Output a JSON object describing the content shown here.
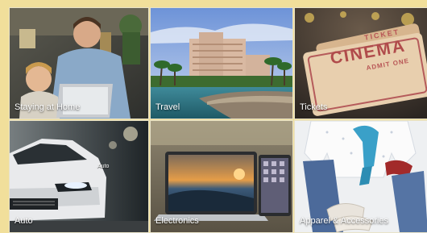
{
  "tiles": [
    {
      "label": "Staying at Home"
    },
    {
      "label": "Travel"
    },
    {
      "label": "Tickets"
    },
    {
      "label": "Auto",
      "badge": "Auto"
    },
    {
      "label": "Electronics"
    },
    {
      "label": "Apparel & Accessories"
    }
  ],
  "tickets": {
    "ticket_text": "TICKET",
    "cinema_text": "CINEMA",
    "admit_text": "ADMIT ONE"
  }
}
